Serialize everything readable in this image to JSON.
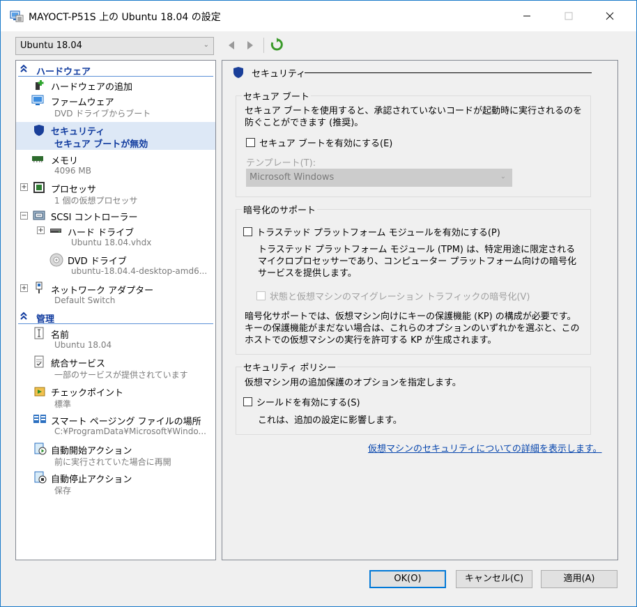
{
  "window": {
    "title": "MAYOCT-P51S 上の Ubuntu 18.04 の設定",
    "minimize": "—",
    "maximize": "☐",
    "close": "✕"
  },
  "toolbar": {
    "vm_selected": "Ubuntu 18.04",
    "back_icon": "back-arrow-icon",
    "forward_icon": "forward-arrow-icon",
    "refresh_icon": "refresh-icon"
  },
  "sidebar": {
    "hardware_header": "ハードウェア",
    "management_header": "管理",
    "items": [
      {
        "label": "ハードウェアの追加",
        "sub": ""
      },
      {
        "label": "ファームウェア",
        "sub": "DVD ドライブからブート"
      },
      {
        "label": "セキュリティ",
        "sub": "セキュア ブートが無効"
      },
      {
        "label": "メモリ",
        "sub": "4096 MB"
      },
      {
        "label": "プロセッサ",
        "sub": "1 個の仮想プロセッサ"
      },
      {
        "label": "SCSI コントローラー",
        "sub": ""
      },
      {
        "label": "ハード ドライブ",
        "sub": "Ubuntu 18.04.vhdx"
      },
      {
        "label": "DVD ドライブ",
        "sub": "ubuntu-18.04.4-desktop-amd6..."
      },
      {
        "label": "ネットワーク アダプター",
        "sub": "Default Switch"
      }
    ],
    "mgmt_items": [
      {
        "label": "名前",
        "sub": "Ubuntu 18.04"
      },
      {
        "label": "統合サービス",
        "sub": "一部のサービスが提供されています"
      },
      {
        "label": "チェックポイント",
        "sub": "標準"
      },
      {
        "label": "スマート ページング ファイルの場所",
        "sub": "C:¥ProgramData¥Microsoft¥Windo..."
      },
      {
        "label": "自動開始アクション",
        "sub": "前に実行されていた場合に再開"
      },
      {
        "label": "自動停止アクション",
        "sub": "保存"
      }
    ]
  },
  "main": {
    "header": "セキュリティ",
    "secure_boot": {
      "title": "セキュア ブート",
      "desc": "セキュア ブートを使用すると、承認されていないコードが起動時に実行されるのを防ぐことができます (推奨)。",
      "checkbox": "セキュア ブートを有効にする(E)",
      "template_label": "テンプレート(T):",
      "template_value": "Microsoft Windows"
    },
    "encryption": {
      "title": "暗号化のサポート",
      "tpm_checkbox": "トラステッド プラットフォーム モジュールを有効にする(P)",
      "tpm_desc": "トラステッド プラットフォーム モジュール (TPM) は、特定用途に限定されるマイクロプロセッサーであり、コンピューター プラットフォーム向けの暗号化サービスを提供します。",
      "migration_checkbox": "状態と仮想マシンのマイグレーション トラフィックの暗号化(V)",
      "note": "暗号化サポートでは、仮想マシン向けにキーの保護機能 (KP) の構成が必要です。キーの保護機能がまだない場合は、これらのオプションのいずれかを選ぶと、このホストでの仮想マシンの実行を許可する KP が生成されます。"
    },
    "policy": {
      "title": "セキュリティ ポリシー",
      "desc": "仮想マシン用の追加保護のオプションを指定します。",
      "shield_checkbox": "シールドを有効にする(S)",
      "shield_note": "これは、追加の設定に影響します。"
    },
    "link": "仮想マシンのセキュリティについての詳細を表示します。"
  },
  "footer": {
    "ok": "OK(O)",
    "cancel": "キャンセル(C)",
    "apply": "適用(A)"
  },
  "colors": {
    "window_border": "#1979ca",
    "selection_bg": "#dde8f6",
    "section_blue": "#0f3a9e",
    "link": "#0645ad",
    "default_button_border": "#0078d7"
  }
}
